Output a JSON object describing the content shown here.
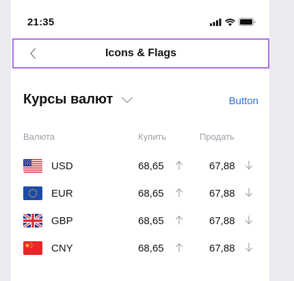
{
  "status_bar": {
    "time": "21:35",
    "icons": [
      "signal-icon",
      "wifi-icon",
      "battery-icon"
    ]
  },
  "nav": {
    "title": "Icons & Flags",
    "back_icon": "chevron-left-icon",
    "highlight_color": "#a86fe2"
  },
  "section": {
    "title": "Курсы валют",
    "dropdown_icon": "chevron-down-icon",
    "button_label": "Button",
    "button_color": "#2f6fde"
  },
  "columns": {
    "currency": "Валюта",
    "buy": "Купить",
    "sell": "Продать"
  },
  "rates": [
    {
      "flag": "us-flag-icon",
      "code": "USD",
      "buy": "68,65",
      "buy_trend": "up",
      "sell": "67,88",
      "sell_trend": "down"
    },
    {
      "flag": "eu-flag-icon",
      "code": "EUR",
      "buy": "68,65",
      "buy_trend": "up",
      "sell": "67,88",
      "sell_trend": "down"
    },
    {
      "flag": "gb-flag-icon",
      "code": "GBP",
      "buy": "68,65",
      "buy_trend": "up",
      "sell": "67,88",
      "sell_trend": "down"
    },
    {
      "flag": "cn-flag-icon",
      "code": "CNY",
      "buy": "68,65",
      "buy_trend": "up",
      "sell": "67,88",
      "sell_trend": "down"
    }
  ]
}
